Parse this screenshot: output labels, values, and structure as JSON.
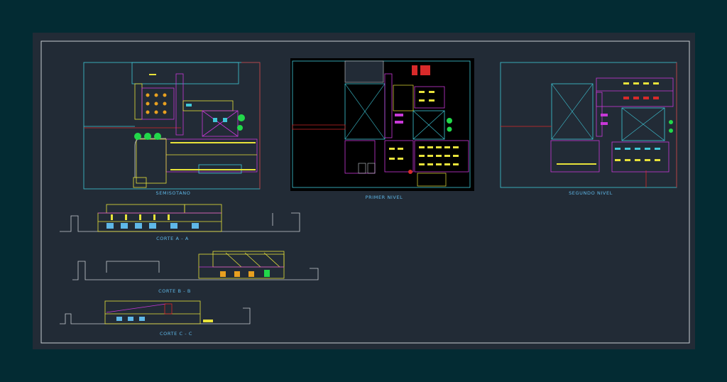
{
  "colors": {
    "page_bg": "#032b33",
    "sheet_bg": "#222b36",
    "frame": "#c8ccd2",
    "cyan": "#3fc8d8",
    "magenta": "#c838d8",
    "yellow": "#e8e23a",
    "red": "#d82a2a",
    "green": "#22d84a",
    "label": "#5fb8e8"
  },
  "plans": {
    "basement": {
      "label": "SEMISOTANO"
    },
    "first_floor": {
      "label": "PRIMER NIVEL"
    },
    "second_floor": {
      "label": "SEGUNDO NIVEL"
    }
  },
  "sections": {
    "a": {
      "label": "CORTE A - A"
    },
    "b": {
      "label": "CORTE B - B"
    },
    "c": {
      "label": "CORTE C - C"
    }
  }
}
